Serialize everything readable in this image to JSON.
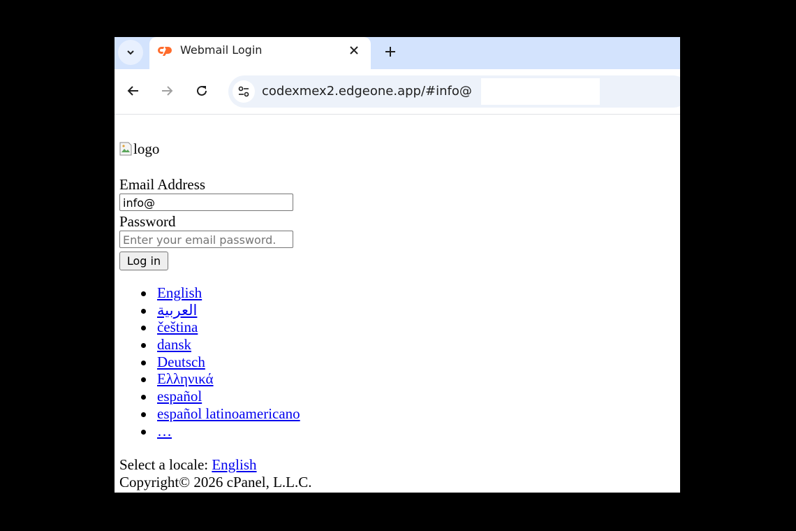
{
  "browser": {
    "tab": {
      "title": "Webmail Login",
      "favicon": "cpanel-logo-icon"
    },
    "url": "codexmex2.edgeone.app/#info@",
    "accent_color": "#d3e3fd",
    "favicon_color": "#ff6c2c"
  },
  "page": {
    "logo_alt": "logo",
    "email": {
      "label": "Email Address",
      "value": "info@"
    },
    "password": {
      "label": "Password",
      "placeholder": "Enter your email password."
    },
    "login_label": "Log in",
    "languages": [
      "English",
      "العربية",
      "čeština",
      "dansk",
      "Deutsch",
      "Ελληνικά",
      "español",
      "español latinoamericano",
      "…"
    ],
    "locale_prefix": "Select a locale:",
    "locale_value": "English",
    "copyright": "Copyright© 2026 cPanel, L.L.C."
  }
}
